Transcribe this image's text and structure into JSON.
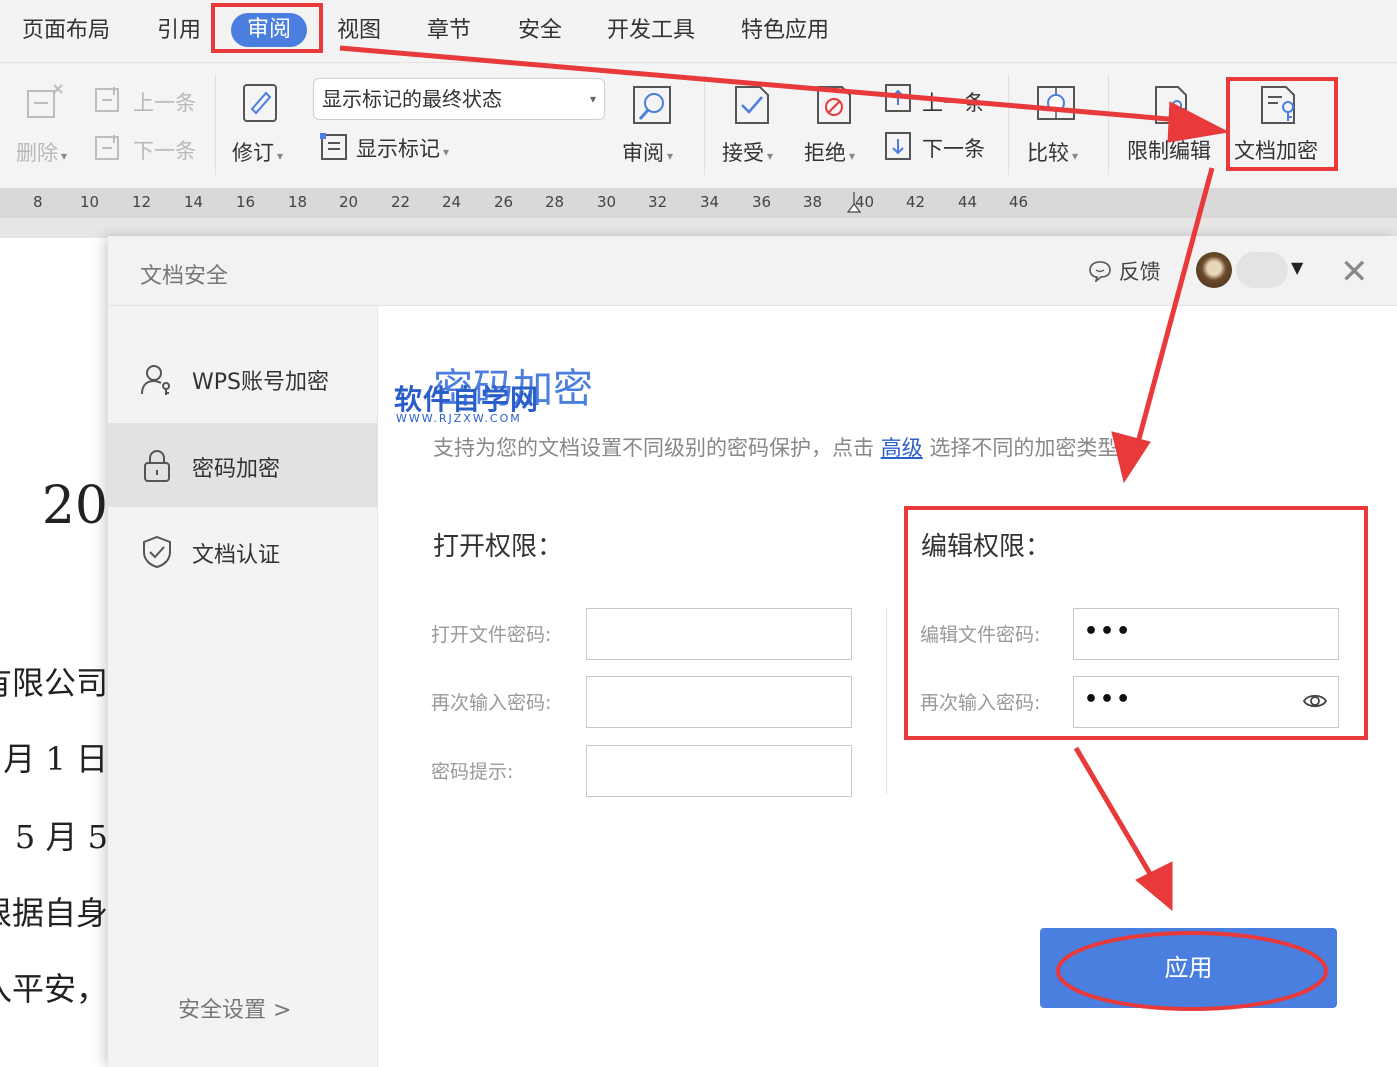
{
  "menubar": {
    "items": [
      "页面布局",
      "引用",
      "审阅",
      "视图",
      "章节",
      "安全",
      "开发工具",
      "特色应用"
    ],
    "active": "审阅"
  },
  "toolbar": {
    "delete_label": "删除",
    "prev_comment_label": "上一条",
    "next_comment_label": "下一条",
    "revise_label": "修订",
    "markup_select_value": "显示标记的最终状态",
    "show_markup_label": "显示标记",
    "review_label": "审阅",
    "accept_label": "接受",
    "reject_label": "拒绝",
    "prev_change_label": "上一条",
    "next_change_label": "下一条",
    "compare_label": "比较",
    "restrict_edit_label": "限制编辑",
    "doc_encrypt_label": "文档加密"
  },
  "ruler": {
    "ticks": [
      "8",
      "10",
      "12",
      "14",
      "16",
      "18",
      "20",
      "22",
      "24",
      "26",
      "28",
      "30",
      "32",
      "34",
      "36",
      "38",
      "40",
      "42",
      "44",
      "46"
    ]
  },
  "document": {
    "lines": [
      "20",
      "有限公司",
      "月 1 日",
      "5 月 5",
      "根据自身",
      "入平安，"
    ]
  },
  "dialog": {
    "title": "文档安全",
    "feedback_label": "反馈",
    "close_symbol": "✕",
    "sidebar": {
      "items": [
        {
          "label": "WPS账号加密",
          "icon": "user-key-icon"
        },
        {
          "label": "密码加密",
          "icon": "lock-icon"
        },
        {
          "label": "文档认证",
          "icon": "shield-check-icon"
        }
      ],
      "active": "密码加密",
      "footer": "安全设置 >"
    },
    "main": {
      "title": "密码加密",
      "watermark": "软件自学网",
      "watermark_sub": "WWW.RJZXW.COM",
      "desc_before": "支持为您的文档设置不同级别的密码保护，点击",
      "desc_link": "高级",
      "desc_after": "选择不同的加密类型",
      "open_section": {
        "title": "打开权限：",
        "fields": [
          {
            "label": "打开文件密码:",
            "value": ""
          },
          {
            "label": "再次输入密码:",
            "value": ""
          },
          {
            "label": "密码提示:",
            "value": ""
          }
        ]
      },
      "edit_section": {
        "title": "编辑权限：",
        "fields": [
          {
            "label": "编辑文件密码:",
            "value": "•••"
          },
          {
            "label": "再次输入密码:",
            "value": "•••"
          }
        ]
      },
      "apply_label": "应用"
    }
  },
  "annotations": {
    "highlight_color": "#e8393b"
  }
}
